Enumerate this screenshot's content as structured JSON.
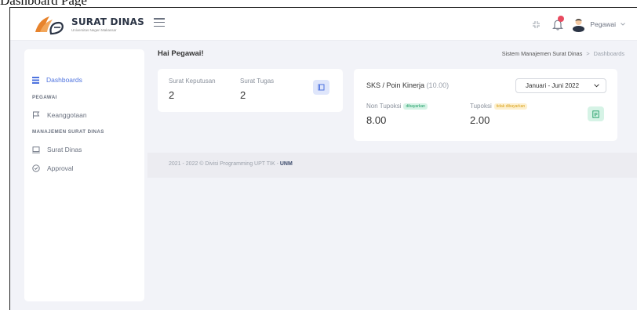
{
  "caption": "Dashboard Page",
  "app": {
    "name": "SURAT DINAS",
    "subtitle": "Universitas Negeri Makassar"
  },
  "user": {
    "name": "Pegawai"
  },
  "sidebar": {
    "items": [
      {
        "label": "Dashboards"
      },
      {
        "heading": "PEGAWAI"
      },
      {
        "label": "Keanggotaan"
      },
      {
        "heading": "MANAJEMEN SURAT DINAS"
      },
      {
        "label": "Surat Dinas"
      },
      {
        "label": "Approval"
      }
    ]
  },
  "main": {
    "greeting": "Hai Pegawai!",
    "breadcrumb": {
      "root": "Sistem Manajemen Surat Dinas",
      "separator": ">",
      "current": "Dashboards"
    }
  },
  "stats": {
    "surat_keputusan_label": "Surat Keputusan",
    "surat_keputusan_value": "2",
    "surat_tugas_label": "Surat Tugas",
    "surat_tugas_value": "2"
  },
  "sks": {
    "title": "SKS / Poin Kinerja",
    "total": "(10.00)",
    "period": "Januari - Juni 2022",
    "non_tupoksi_label": "Non Tupoksi",
    "non_tupoksi_badge": "dibayarkan",
    "non_tupoksi_value": "8.00",
    "tupoksi_label": "Tupoksi",
    "tupoksi_badge": "tidak dibayarkan",
    "tupoksi_value": "2.00"
  },
  "footer": {
    "text": "2021 - 2022 © Divisi Programming UPT TIK - ",
    "brand": "UNM"
  },
  "colors": {
    "accent": "#4e73df",
    "success": "#1c9c64",
    "warning": "#d9a016",
    "notification": "#e84a5f"
  },
  "icons": [
    "hamburger-icon",
    "fullscreen-icon",
    "bell-icon",
    "avatar-icon",
    "grid-icon",
    "flag-icon",
    "monitor-icon",
    "check-circle-icon",
    "book-icon",
    "document-icon"
  ]
}
